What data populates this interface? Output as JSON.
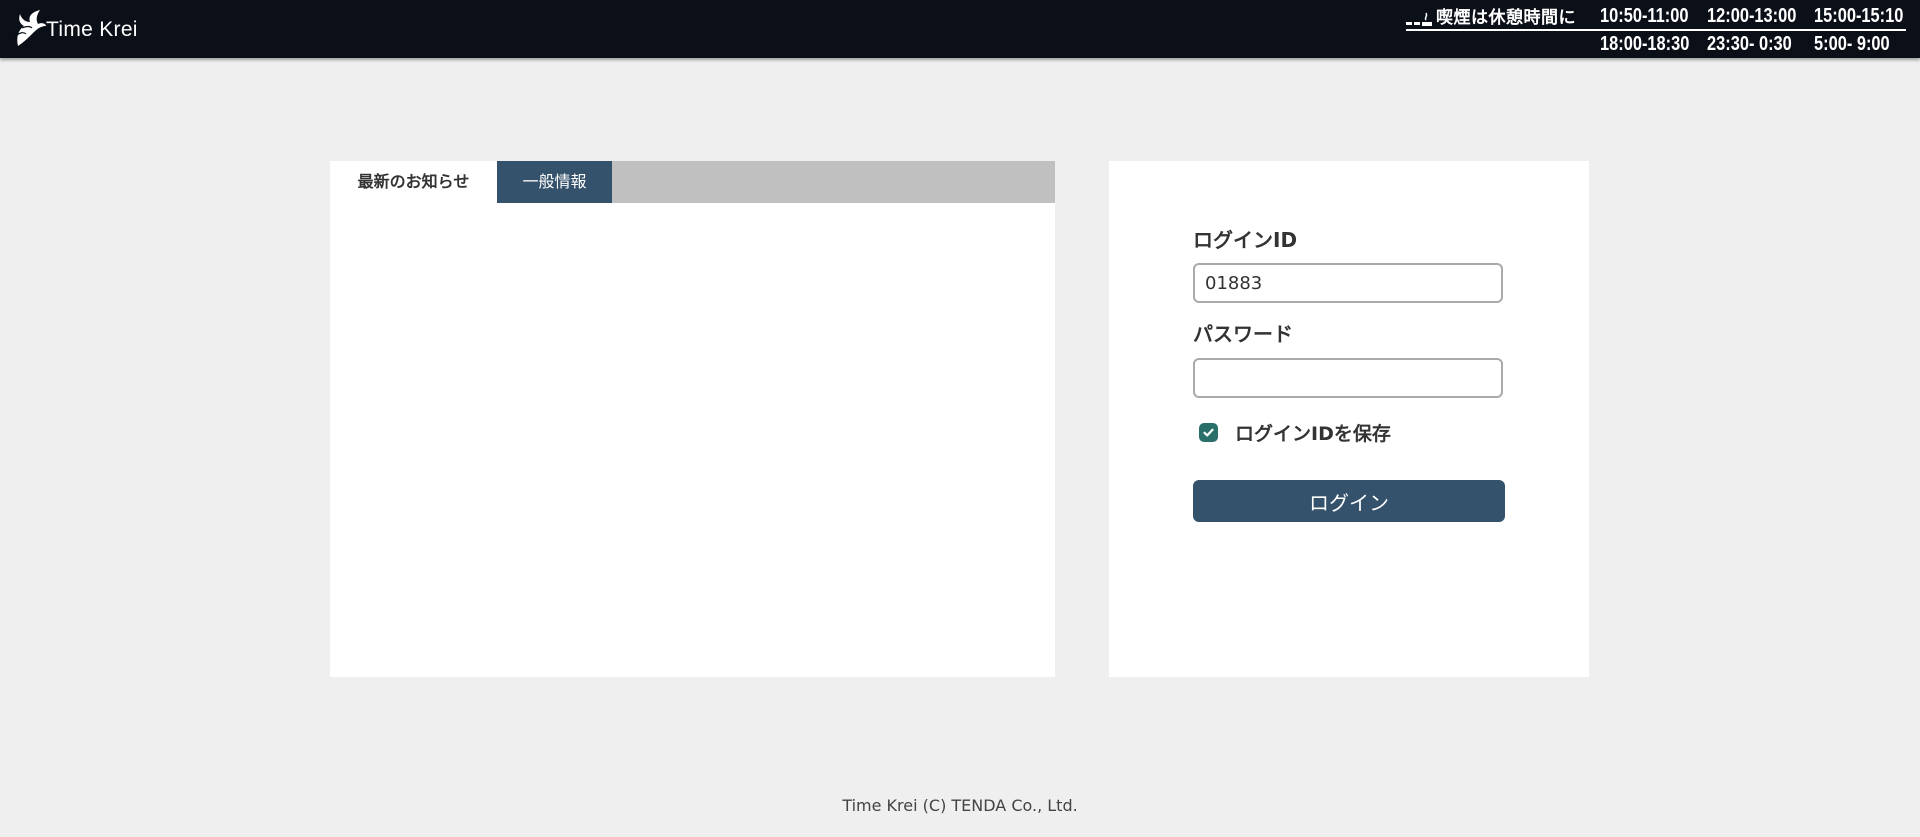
{
  "header": {
    "logo_text": "Time Krei",
    "smoking": {
      "label": "喫煙は休憩時間に",
      "times_row1": [
        "10:50-11:00",
        "12:00-13:00",
        "15:00-15:10"
      ],
      "times_row2": [
        "18:00-18:30",
        "23:30- 0:30",
        "5:00- 9:00"
      ]
    }
  },
  "news": {
    "tabs": [
      {
        "label": "最新のお知らせ",
        "active": true
      },
      {
        "label": "一般情報",
        "active": false
      }
    ]
  },
  "login": {
    "id_label": "ログインID",
    "id_value": "01883",
    "password_label": "パスワード",
    "password_value": "",
    "remember_label": "ログインIDを保存",
    "remember_checked": true,
    "submit_label": "ログイン"
  },
  "footer": {
    "copyright": "Time Krei (C) TENDA Co., Ltd."
  },
  "colors": {
    "header_bg": "#0a0f18",
    "accent": "#34526b",
    "checkbox": "#2b6f6a",
    "page_bg": "#efefef"
  }
}
